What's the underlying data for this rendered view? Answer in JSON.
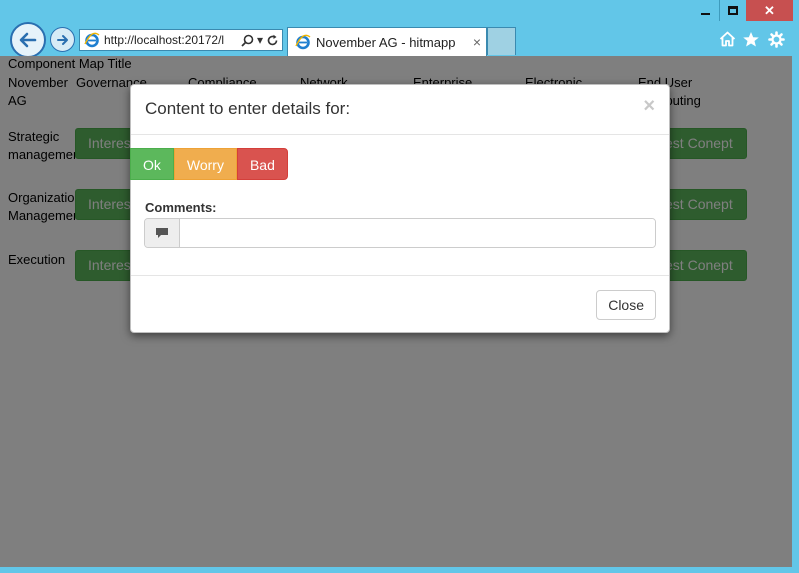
{
  "browser": {
    "address": "http://localhost:20172/l",
    "tab_title": "November AG - hitmapp",
    "tab_close": "×",
    "window_close": "✕"
  },
  "page": {
    "title": "Component Map Title",
    "corner_header": "November AG",
    "columns": [
      "Governance",
      "Compliance",
      "Network",
      "Enterprise",
      "Electronic",
      "End User Computing"
    ],
    "rows": [
      {
        "label": "Strategic management",
        "first_cell": "Interest Conept",
        "last_cell": "Interest Conept"
      },
      {
        "label": "Organization Management",
        "first_cell": "Interest Conept",
        "last_cell": "Interest Conept"
      },
      {
        "label": "Execution",
        "first_cell": "Interest Conept",
        "last_cell": "Interest Conept"
      }
    ]
  },
  "modal": {
    "title": "Content to enter details for:",
    "close_x": "×",
    "status_buttons": [
      "Ok",
      "Worry",
      "Bad"
    ],
    "comments_label": "Comments:",
    "comments_value": "",
    "comments_placeholder": "",
    "close_button": "Close"
  },
  "colors": {
    "ok": "#5cb85c",
    "worry": "#f0ad4e",
    "bad": "#d9534f",
    "chrome": "#62c6e8"
  },
  "icons": [
    "back-arrow-icon",
    "forward-arrow-icon",
    "ie-logo-icon",
    "search-icon",
    "refresh-icon",
    "home-icon",
    "star-icon",
    "gear-icon",
    "comment-icon"
  ]
}
